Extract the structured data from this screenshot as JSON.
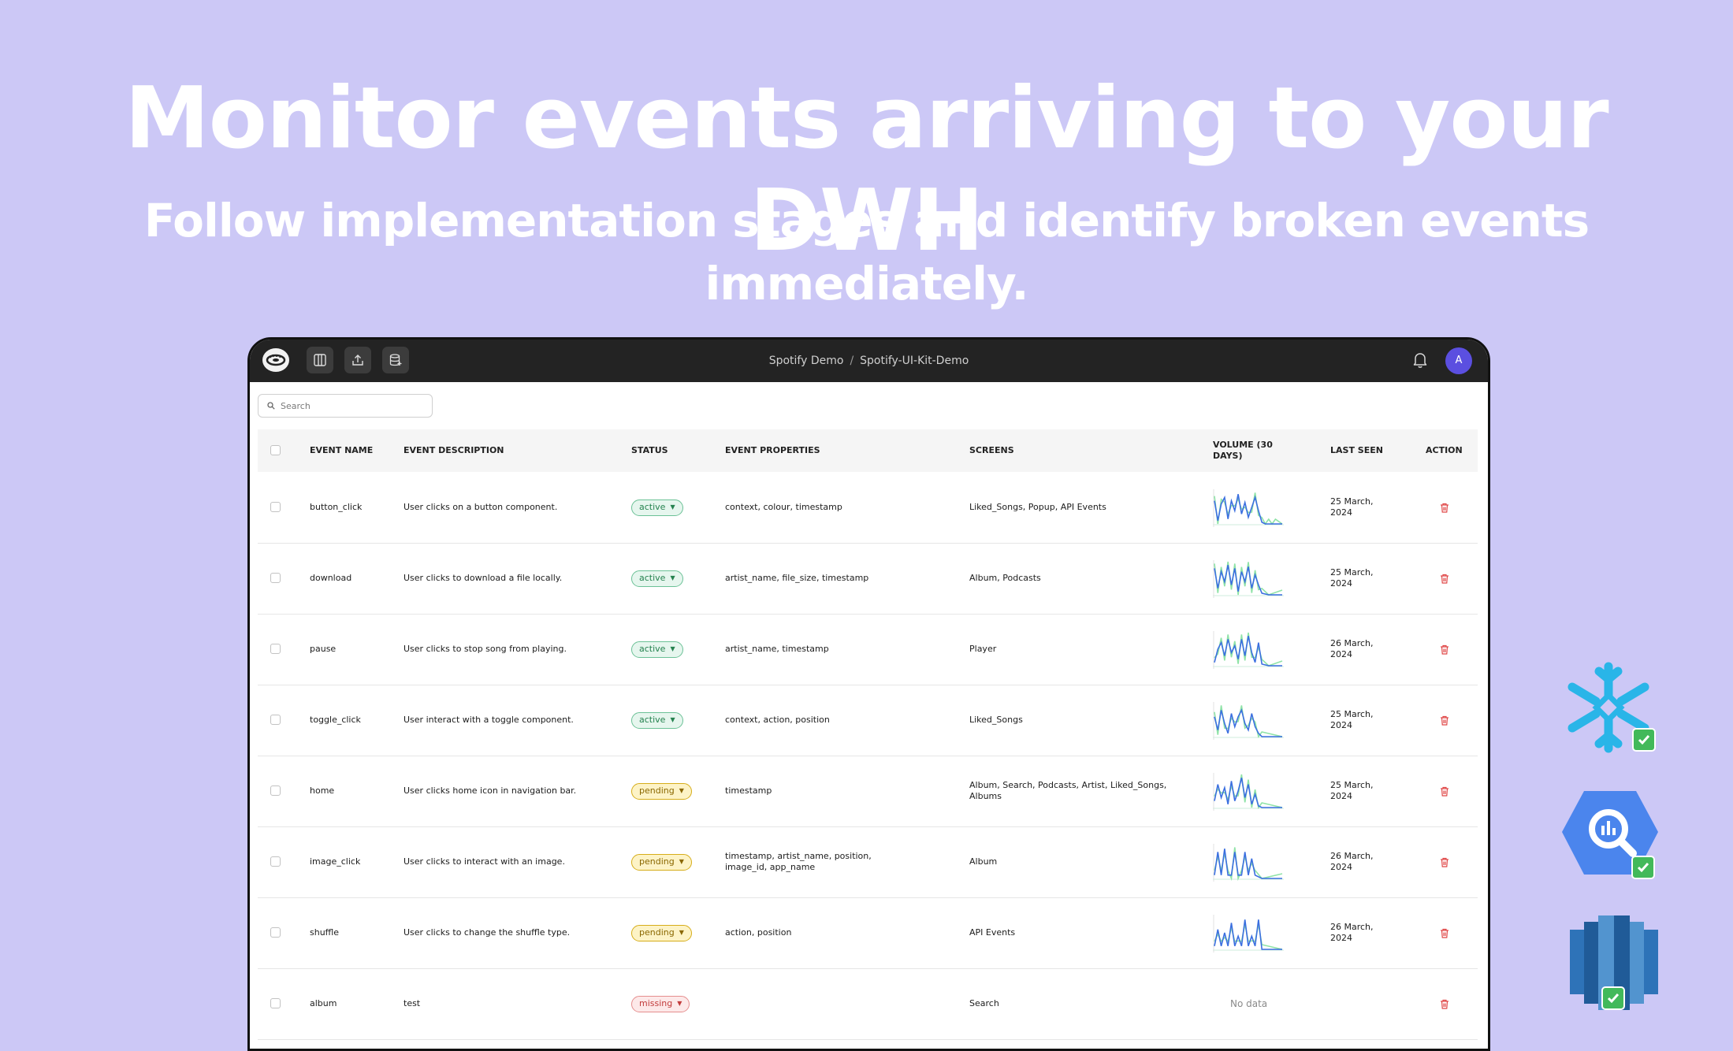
{
  "hero": {
    "title": "Monitor events arriving to your DWH",
    "subtitle": "Follow implementation stages and identify broken events immediately."
  },
  "topbar": {
    "breadcrumb": [
      "Spotify Demo",
      "Spotify-UI-Kit-Demo"
    ],
    "separator": "/",
    "avatar_initial": "A",
    "icons": [
      "logo-icon",
      "columns-icon",
      "upload-icon",
      "database-icon",
      "bell-icon"
    ]
  },
  "search": {
    "placeholder": "Search",
    "value": ""
  },
  "table": {
    "columns": {
      "name": "EVENT NAME",
      "description": "EVENT DESCRIPTION",
      "status": "STATUS",
      "properties": "EVENT PROPERTIES",
      "screens": "SCREENS",
      "volume": "VOLUME (30 DAYS)",
      "last_seen": "LAST SEEN",
      "action": "ACTION"
    },
    "rows": [
      {
        "name": "button_click",
        "description": "User clicks on a button component.",
        "status": "active",
        "properties": "context, colour, timestamp",
        "screens": "Liked_Songs, Popup, API Events",
        "last_seen": "25 March, 2024"
      },
      {
        "name": "download",
        "description": "User clicks to download a file locally.",
        "status": "active",
        "properties": "artist_name, file_size, timestamp",
        "screens": "Album, Podcasts",
        "last_seen": "25 March, 2024"
      },
      {
        "name": "pause",
        "description": "User clicks to stop song from playing.",
        "status": "active",
        "properties": "artist_name, timestamp",
        "screens": "Player",
        "last_seen": "26 March, 2024"
      },
      {
        "name": "toggle_click",
        "description": "User interact with a toggle component.",
        "status": "active",
        "properties": "context, action, position",
        "screens": "Liked_Songs",
        "last_seen": "25 March, 2024"
      },
      {
        "name": "home",
        "description": "User clicks home icon in navigation bar.",
        "status": "pending",
        "properties": "timestamp",
        "screens": "Album, Search, Podcasts, Artist, Liked_Songs, Albums",
        "last_seen": "25 March, 2024"
      },
      {
        "name": "image_click",
        "description": "User clicks to interact with an image.",
        "status": "pending",
        "properties": "timestamp, artist_name, position, image_id, app_name",
        "screens": "Album",
        "last_seen": "26 March, 2024"
      },
      {
        "name": "shuffle",
        "description": "User clicks to change the shuffle type.",
        "status": "pending",
        "properties": "action, position",
        "screens": "API Events",
        "last_seen": "26 March, 2024"
      },
      {
        "name": "album",
        "description": "test",
        "status": "missing",
        "properties": "",
        "screens": "Search",
        "last_seen": "",
        "volume_text": "No data"
      }
    ]
  },
  "colors": {
    "background": "#ccc8f6",
    "topbar": "#232323",
    "sparkline_blue": "#3b6fe0",
    "sparkline_green": "#8fe3a7",
    "active": "#25824f",
    "pending": "#8a6700",
    "missing": "#c23b3b",
    "delete": "#e04848"
  },
  "integrations": [
    "snowflake-icon",
    "bigquery-icon",
    "redshift-icon"
  ]
}
